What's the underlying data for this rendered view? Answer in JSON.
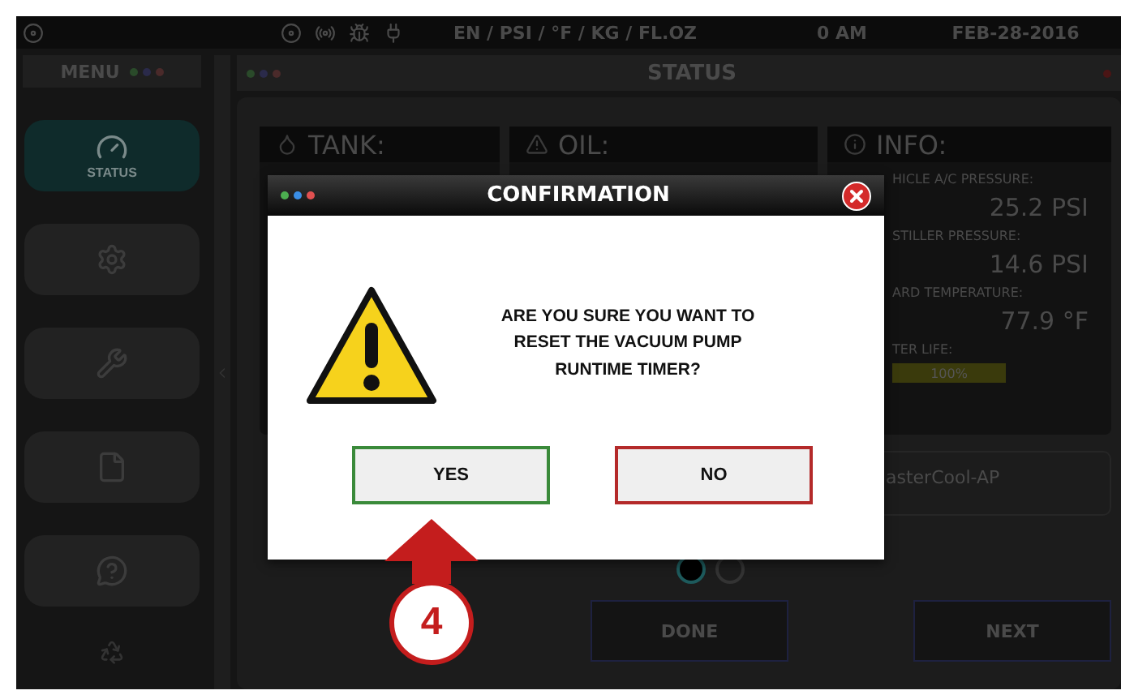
{
  "status_bar": {
    "units": "EN / PSI / °F / KG / FL.OZ",
    "time": "0 AM",
    "date": "FEB-28-2016"
  },
  "sidebar": {
    "title": "MENU",
    "items": [
      {
        "label": "STATUS",
        "kind": "status",
        "selected": true
      },
      {
        "kind": "settings",
        "selected": false
      },
      {
        "kind": "tools",
        "selected": false
      },
      {
        "kind": "file",
        "selected": false
      },
      {
        "kind": "help",
        "selected": false
      }
    ]
  },
  "panel": {
    "title": "STATUS",
    "cards": [
      {
        "title": "TANK:",
        "kind": "tank"
      },
      {
        "title": "OIL:",
        "kind": "oil"
      },
      {
        "title": "INFO:",
        "kind": "info"
      }
    ],
    "info": [
      {
        "label": "HICLE A/C PRESSURE:",
        "value": "25.2 PSI"
      },
      {
        "label": "STILLER PRESSURE:",
        "value": "14.6 PSI"
      },
      {
        "label": "ARD TEMPERATURE:",
        "value": "77.9 °F"
      },
      {
        "label": "TER LIFE:",
        "meter_text": "100%",
        "level": 1
      }
    ],
    "device": "asterCool-AP",
    "pages": [
      {
        "selected": true
      },
      {
        "selected": false
      }
    ],
    "buttons": [
      "DONE",
      "NEXT"
    ]
  },
  "dialog": {
    "title": "CONFIRMATION",
    "message": "ARE YOU SURE YOU WANT TO RESET THE VACUUM PUMP RUNTIME TIMER?",
    "buttons": [
      {
        "label": "YES",
        "kind": "confirm"
      },
      {
        "label": "NO",
        "kind": "cancel"
      }
    ]
  },
  "callout": {
    "number": "4"
  }
}
